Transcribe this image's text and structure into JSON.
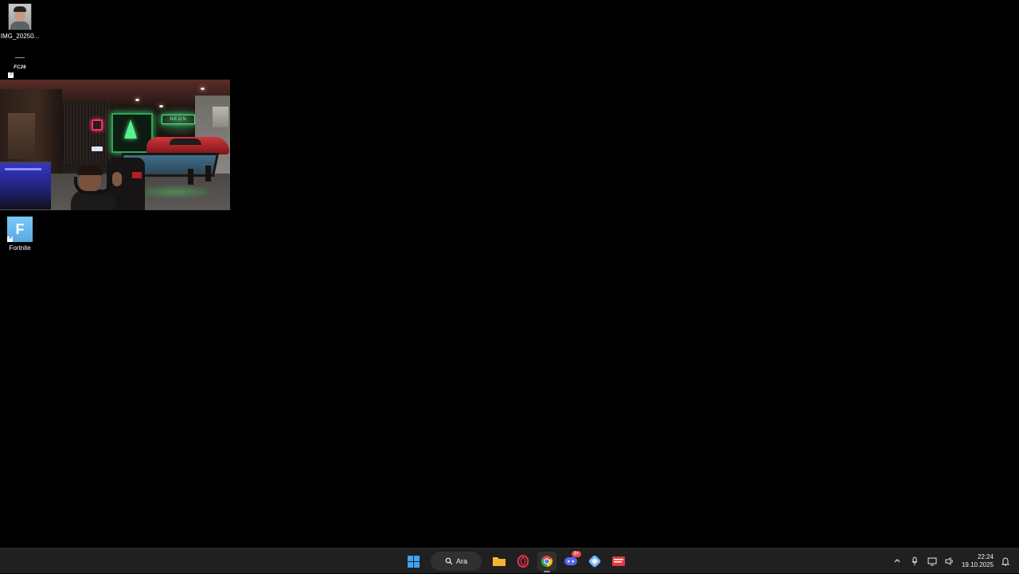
{
  "desktop": {
    "icons": [
      {
        "label": "IMG_20250...",
        "icon": "portrait-photo-icon"
      },
      {
        "label": "",
        "icon": "fc26-icon",
        "brand_text": "FC26"
      },
      {
        "label": "Fortnite",
        "icon": "fortnite-icon"
      }
    ],
    "video_overlay": {
      "icon": "webcam-video-icon",
      "sign_text": "NEON"
    }
  },
  "taskbar": {
    "start_icon": "windows-start-icon",
    "search_label": "Ara",
    "apps": [
      {
        "name": "file-explorer",
        "icon": "folder-icon"
      },
      {
        "name": "opera-gx",
        "icon": "opera-gx-icon"
      },
      {
        "name": "chrome",
        "icon": "chrome-icon"
      },
      {
        "name": "discord",
        "icon": "discord-icon",
        "badge": "9+"
      },
      {
        "name": "app-store",
        "icon": "app-icon"
      },
      {
        "name": "media-app",
        "icon": "media-player-icon"
      }
    ],
    "tray": {
      "chevron_icon": "chevron-up-icon",
      "mic_icon": "microphone-icon",
      "network_icon": "network-icon",
      "volume_icon": "volume-icon",
      "time": "22:24",
      "date": "19.10.2025",
      "notification_icon": "notification-icon"
    }
  }
}
